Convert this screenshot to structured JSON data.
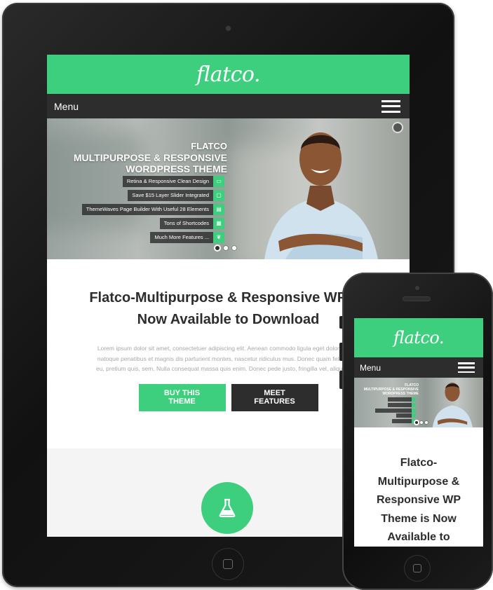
{
  "tablet": {
    "logo": "flatco.",
    "menu_label": "Menu",
    "hero": {
      "title_lines": [
        "FLATCO",
        "MULTIPURPOSE & RESPONSIVE",
        "WORDPRESS THEME"
      ],
      "features": [
        {
          "label": "Retina & Responsive Clean Design",
          "icon": "monitor-icon"
        },
        {
          "label": "Save $15 Layer Slider Integrated",
          "icon": "screen-icon"
        },
        {
          "label": "ThemeWaves Page Builder With Useful 28 Elements",
          "icon": "builder-icon"
        },
        {
          "label": "Tons of Shortcodes",
          "icon": "grid-icon"
        },
        {
          "label": "Much More Features ...",
          "icon": "leaf-icon"
        }
      ]
    },
    "main": {
      "heading_line1": "Flatco-Multipurpose & Responsive WP Th",
      "heading_line2": "Now Available to Download",
      "lorem_lines": [
        "Lorem ipsum dolor sit amet, consectetuer adipiscing elit. Aenean commodo ligula eget dolor. Aenea",
        "natoque penatibus et magnis dis parturient montes, nascetur ridiculus mus. Donec quam felis, ultric",
        "eu, pretium quis, sem. Nulla consequat massa quis enim. Donec pede justo, fringilla vel, aliquet nec,"
      ],
      "buy_label": "BUY THIS THEME",
      "features_label": "MEET FEATURES"
    }
  },
  "phone": {
    "logo": "flatco.",
    "menu_label": "Menu",
    "hero": {
      "title_lines": [
        "FLATCO",
        "MULTIPURPOSE & RESPONSIVE",
        "WORDPRESS THEME"
      ]
    },
    "main": {
      "heading_lines": [
        "Flatco-",
        "Multipurpose &",
        "Responsive WP",
        "Theme is Now",
        "Available to"
      ]
    }
  },
  "colors": {
    "accent": "#3ecf7e",
    "dark": "#2d2d2d",
    "device": "#111111"
  }
}
